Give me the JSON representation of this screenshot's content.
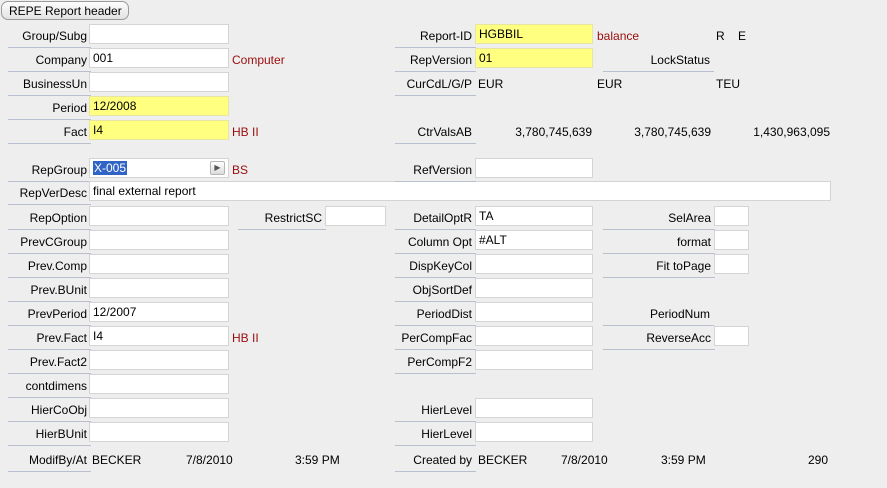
{
  "tab": {
    "title": "REPE Report header"
  },
  "fields": {
    "group_subg": {
      "label": "Group/Subg",
      "value": ""
    },
    "company": {
      "label": "Company",
      "value": "001",
      "desc": "Computer"
    },
    "business_un": {
      "label": "BusinessUn",
      "value": ""
    },
    "period": {
      "label": "Period",
      "value": "12/2008"
    },
    "fact": {
      "label": "Fact",
      "value": "I4",
      "desc": "HB II"
    },
    "rep_group": {
      "label": "RepGroup",
      "value": "X-005",
      "desc": "BS",
      "arrow_icon": "play-arrow-icon"
    },
    "rep_ver_desc": {
      "label": "RepVerDesc",
      "value": "final external report"
    },
    "rep_option": {
      "label": "RepOption",
      "value": ""
    },
    "restrict_sc": {
      "label": "RestrictSC",
      "value": ""
    },
    "prev_c_group": {
      "label": "PrevCGroup",
      "value": ""
    },
    "prev_comp": {
      "label": "Prev.Comp",
      "value": ""
    },
    "prev_b_unit": {
      "label": "Prev.BUnit",
      "value": ""
    },
    "prev_period": {
      "label": "PrevPeriod",
      "value": "12/2007"
    },
    "prev_fact": {
      "label": "Prev.Fact",
      "value": "I4",
      "desc": "HB II"
    },
    "prev_fact2": {
      "label": "Prev.Fact2",
      "value": ""
    },
    "contdimens": {
      "label": "contdimens",
      "value": ""
    },
    "hier_co_obj": {
      "label": "HierCoObj",
      "value": ""
    },
    "hier_b_unit": {
      "label": "HierBUnit",
      "value": ""
    },
    "report_id": {
      "label": "Report-ID",
      "value": "HGBBIL",
      "desc": "balance",
      "flag1": "R",
      "flag2": "E"
    },
    "rep_version": {
      "label": "RepVersion",
      "value": "01"
    },
    "lock_status": {
      "label": "LockStatus"
    },
    "cur_cd": {
      "label": "CurCdL/G/P",
      "local": "EUR",
      "group": "EUR",
      "param": "TEU"
    },
    "ctr_vals_ab": {
      "label": "CtrValsAB",
      "v1": "3,780,745,639",
      "v2": "3,780,745,639",
      "v3": "1,430,963,095"
    },
    "ref_version": {
      "label": "RefVersion",
      "value": ""
    },
    "detail_opt_r": {
      "label": "DetailOptR",
      "value": "TA"
    },
    "column_opt": {
      "label": "Column Opt",
      "value": "#ALT"
    },
    "disp_key_col": {
      "label": "DispKeyCol",
      "value": ""
    },
    "obj_sort_def": {
      "label": "ObjSortDef",
      "value": ""
    },
    "period_dist": {
      "label": "PeriodDist",
      "value": ""
    },
    "per_comp_fac": {
      "label": "PerCompFac",
      "value": ""
    },
    "per_comp_f2": {
      "label": "PerCompF2",
      "value": ""
    },
    "hier_level1": {
      "label": "HierLevel",
      "value": ""
    },
    "hier_level2": {
      "label": "HierLevel",
      "value": ""
    },
    "sel_area": {
      "label": "SelArea",
      "value": ""
    },
    "format": {
      "label": "format",
      "value": ""
    },
    "fit_to_page": {
      "label": "Fit toPage",
      "value": ""
    },
    "period_num": {
      "label": "PeriodNum"
    },
    "reverse_acc": {
      "label": "ReverseAcc",
      "value": ""
    }
  },
  "footer": {
    "modif_label": "ModifBy/At",
    "modif_by": "BECKER",
    "modif_date": "7/8/2010",
    "modif_time": "3:59 PM",
    "created_label": "Created by",
    "created_by": "BECKER",
    "created_date": "7/8/2010",
    "created_time": "3:59 PM",
    "count": "290"
  }
}
